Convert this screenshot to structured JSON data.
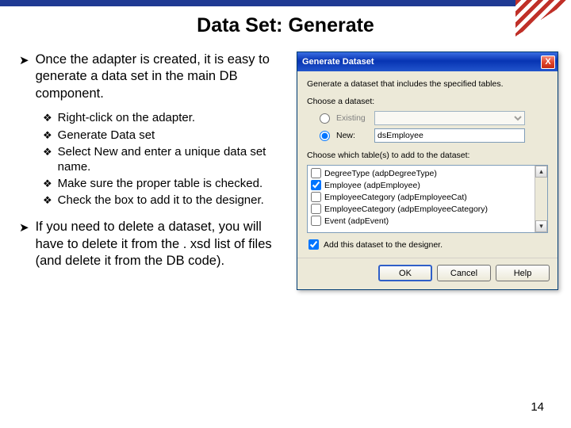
{
  "title": "Data Set: Generate",
  "bullets": {
    "b1": "Once the adapter is created, it is easy to generate a data set in the main DB component.",
    "subs": [
      "Right-click on the adapter.",
      "Generate Data set",
      "Select New and enter a unique data set name.",
      "Make sure the proper table is checked.",
      "Check the box to add it to the designer."
    ],
    "b2": "If you need to delete a dataset, you will have to delete it from the . xsd list of files (and delete it from the DB code)."
  },
  "dialog": {
    "title": "Generate Dataset",
    "close": "X",
    "instr": "Generate a dataset that includes the specified tables.",
    "choose": "Choose a dataset:",
    "existing": "Existing",
    "newlbl": "New:",
    "newval": "dsEmployee",
    "tables_lbl": "Choose which table(s) to add to the dataset:",
    "items": [
      {
        "label": "DegreeType (adpDegreeType)",
        "checked": false
      },
      {
        "label": "Employee (adpEmployee)",
        "checked": true
      },
      {
        "label": "EmployeeCategory (adpEmployeeCat)",
        "checked": false
      },
      {
        "label": "EmployeeCategory (adpEmployeeCategory)",
        "checked": false
      },
      {
        "label": "Event (adpEvent)",
        "checked": false
      }
    ],
    "adddesigner": "Add this dataset to the designer.",
    "ok": "OK",
    "cancel": "Cancel",
    "help": "Help"
  },
  "pagenum": "14"
}
